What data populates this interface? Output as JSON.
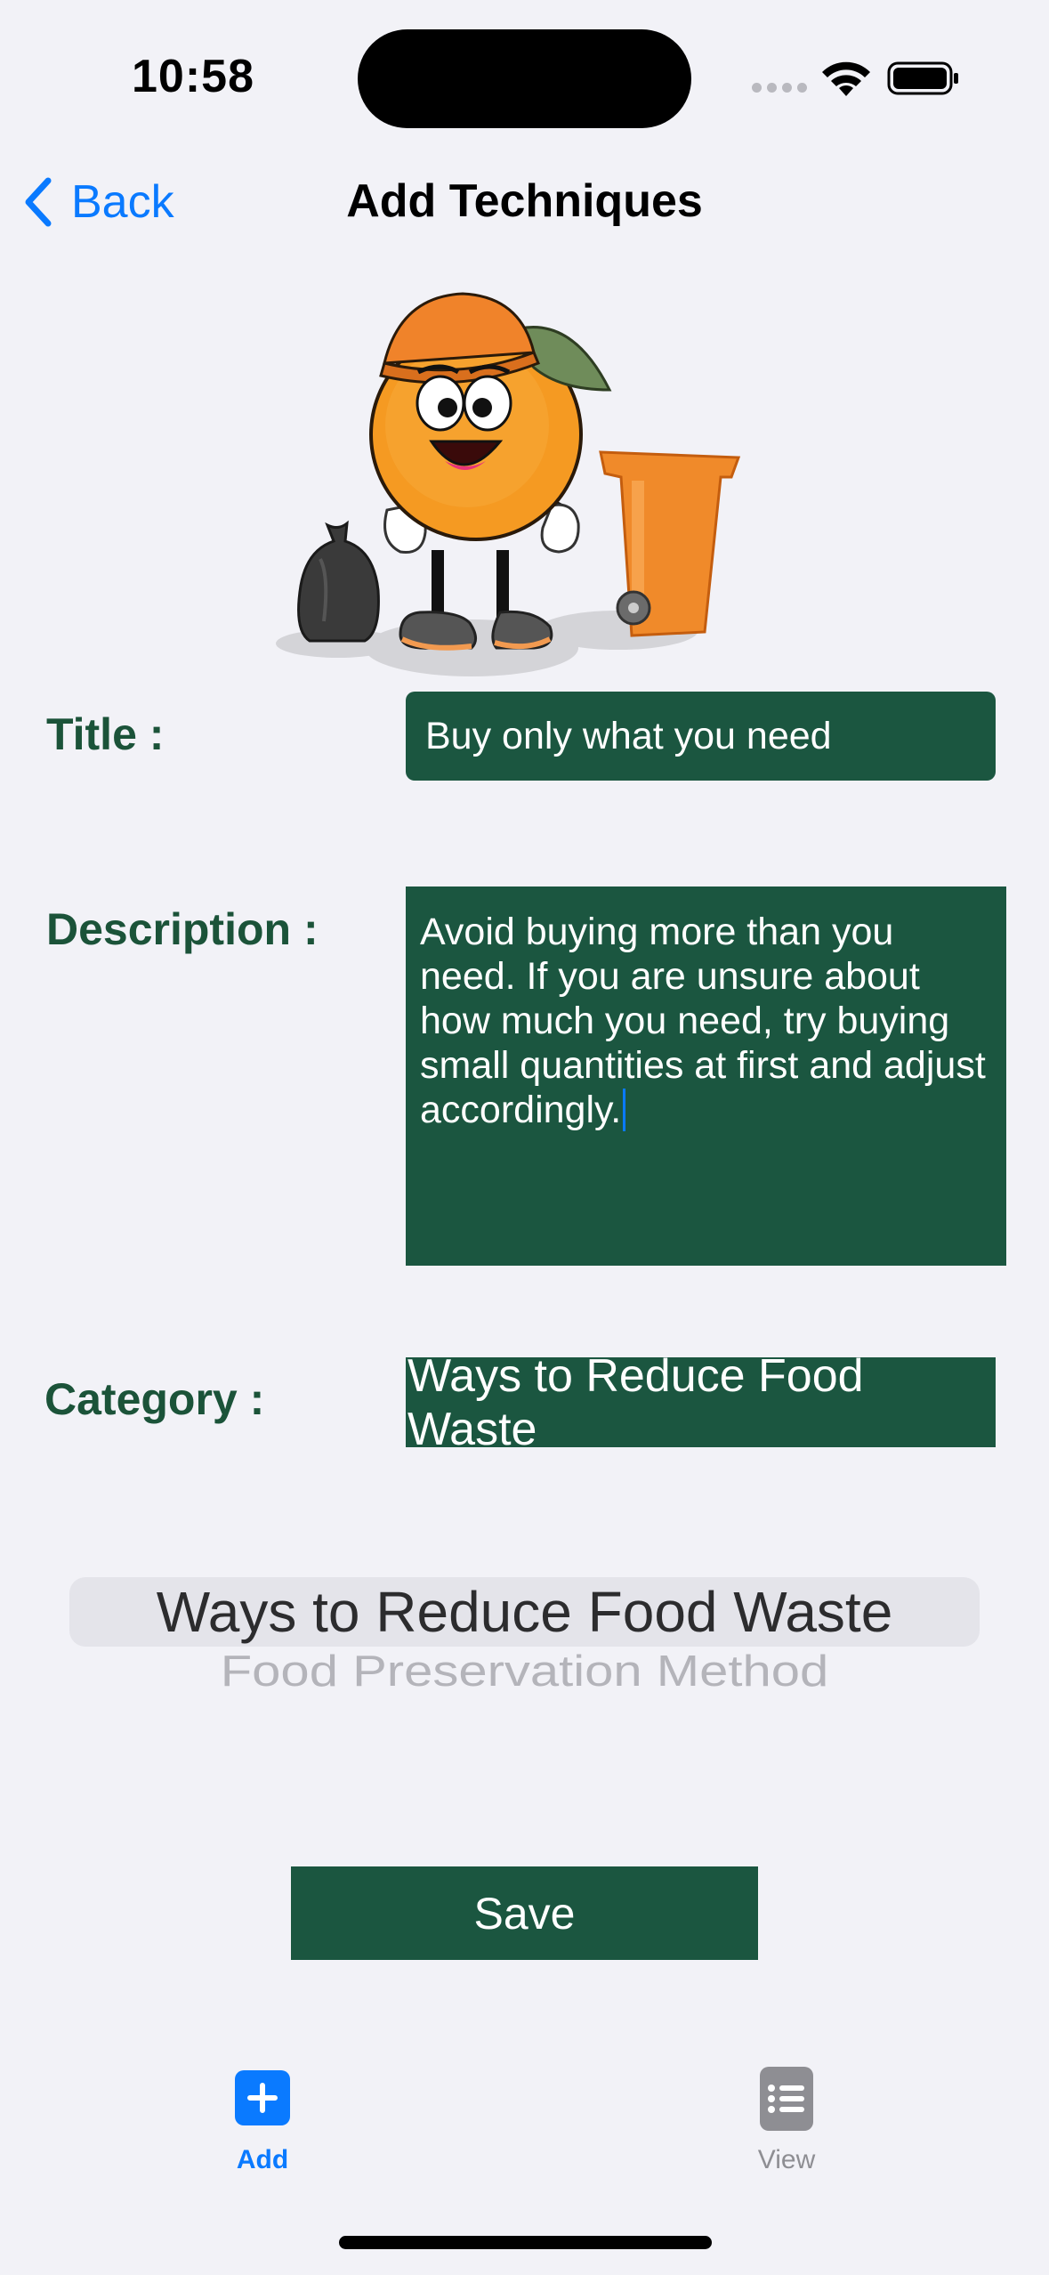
{
  "status_bar": {
    "time": "10:58"
  },
  "nav": {
    "back_label": "Back",
    "title": "Add Techniques"
  },
  "form": {
    "title_label": "Title :",
    "title_value": "Buy only what you need",
    "description_label": "Description :",
    "description_value": "Avoid buying more than you need. If you are unsure about how much you need, try buying small quantities at first and adjust accordingly.",
    "category_label": "Category :",
    "category_value": "Ways to Reduce Food Waste"
  },
  "picker": {
    "options": [
      "Ways to Reduce Food Waste",
      "Food Preservation Method"
    ],
    "selected": "Ways to Reduce Food Waste"
  },
  "save_label": "Save",
  "tab_bar": {
    "tabs": [
      {
        "label": "Add",
        "icon": "plus-icon",
        "active": true
      },
      {
        "label": "View",
        "icon": "list-icon",
        "active": false
      }
    ]
  },
  "colors": {
    "accent": "#0a7aff",
    "form_green": "#1b5640",
    "label_green": "#1b5339",
    "background": "#f2f2f7"
  }
}
